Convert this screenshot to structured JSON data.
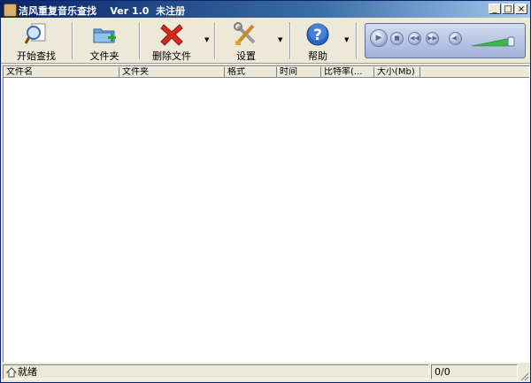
{
  "window": {
    "title": "洁风重复音乐查找    Ver 1.0  未注册",
    "controls": {
      "minimize": "_",
      "maximize": "□",
      "close": "×"
    }
  },
  "toolbar": {
    "buttons": [
      {
        "label": "开始查找",
        "icon": "search-magnifier-icon",
        "has_dropdown": false
      },
      {
        "label": "文件夹",
        "icon": "add-folder-icon",
        "has_dropdown": false
      },
      {
        "label": "删除文件",
        "icon": "delete-x-icon",
        "has_dropdown": true
      },
      {
        "label": "设置",
        "icon": "tools-wrench-icon",
        "has_dropdown": true
      },
      {
        "label": "帮助",
        "icon": "help-question-icon",
        "has_dropdown": true
      }
    ],
    "dropdown_glyph": "▼"
  },
  "player": {
    "buttons": [
      "play",
      "stop",
      "previous",
      "next",
      "mute"
    ],
    "glyphs": {
      "play": "▶",
      "stop": "■",
      "previous": "◀◀",
      "next": "▶▶",
      "mute": "◀)"
    }
  },
  "list": {
    "columns": [
      "文件名",
      "文件夹",
      "格式",
      "时间",
      "比特率(...",
      "大小(Mb)"
    ],
    "rows": []
  },
  "status": {
    "text": "就绪",
    "count": "0/0"
  },
  "colors": {
    "title_start": "#0a246a",
    "title_end": "#a6caf0",
    "face": "#ece9d8",
    "delete_red": "#d8281f",
    "help_blue": "#2a62c8",
    "volume_green": "#39b54a"
  }
}
